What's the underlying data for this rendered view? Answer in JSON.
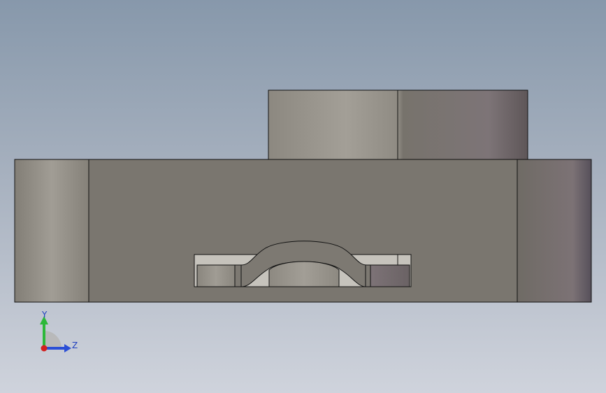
{
  "viewport": {
    "background_top": "#8798ab",
    "background_bottom": "#cfd3dc"
  },
  "model": {
    "body_color": "#7a766f",
    "outline_color": "#111111"
  },
  "triad": {
    "y_label": "Y",
    "z_label": "Z",
    "y_color": "#2db83a",
    "z_color": "#2b4fd6",
    "origin_color": "#d21f1f"
  }
}
